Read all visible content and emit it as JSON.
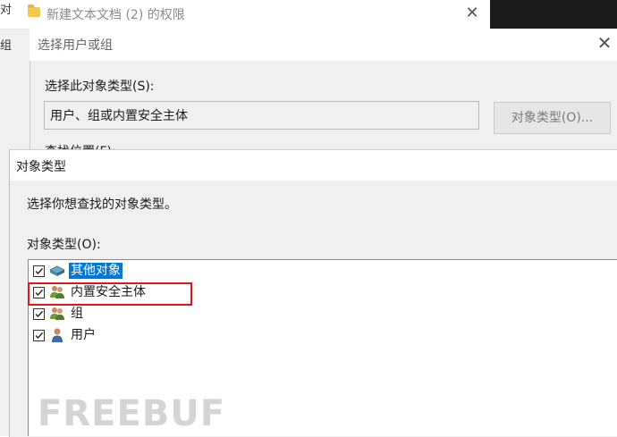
{
  "background_window": {
    "title": "新建文本文档 (2) 的权限",
    "left_fragment_1": "对",
    "left_fragment_2": "组"
  },
  "select_users_dialog": {
    "title": "选择用户或组",
    "object_types_label": "选择此对象类型(S):",
    "object_types_value": "用户、组或内置安全主体",
    "object_types_button": "对象类型(O)...",
    "location_label": "查找位置(F):"
  },
  "object_types_dialog": {
    "title": "对象类型",
    "description": "选择你想查找的对象类型。",
    "list_label": "对象类型(O):",
    "items": [
      {
        "label": "其他对象",
        "checked": true,
        "selected": true,
        "icon": "computer-icon"
      },
      {
        "label": "内置安全主体",
        "checked": true,
        "selected": false,
        "icon": "users-icon"
      },
      {
        "label": "组",
        "checked": true,
        "selected": false,
        "icon": "group-icon"
      },
      {
        "label": "用户",
        "checked": true,
        "selected": false,
        "icon": "user-icon"
      }
    ]
  },
  "watermark": "FREEBUF",
  "colors": {
    "selection": "#0078d7",
    "highlight_box": "#e4141b"
  }
}
